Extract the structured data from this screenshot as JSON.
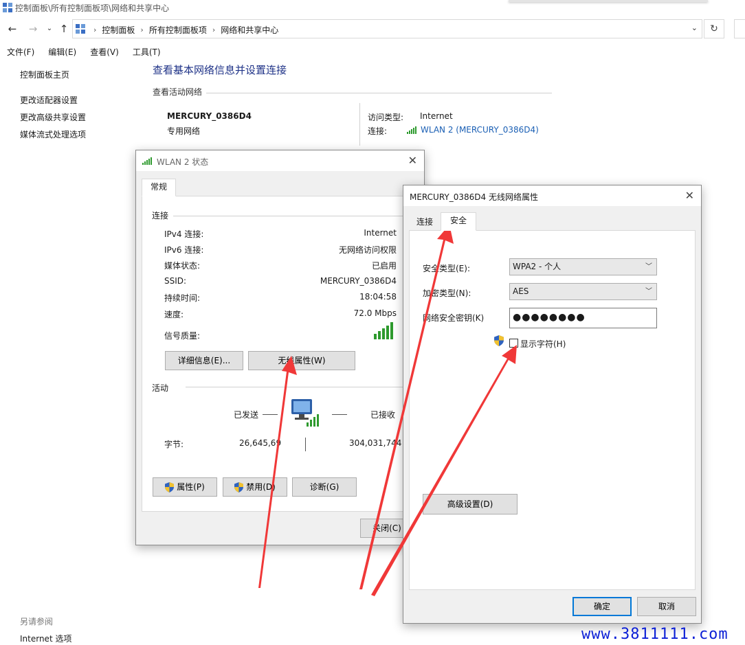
{
  "window": {
    "title": "控制面板\\所有控制面板项\\网络和共享中心"
  },
  "address": {
    "crumbs": [
      "控制面板",
      "所有控制面板项",
      "网络和共享中心"
    ]
  },
  "menu": [
    "文件(F)",
    "编辑(E)",
    "查看(V)",
    "工具(T)"
  ],
  "left_pane": {
    "home": "控制面板主页",
    "links": [
      "更改适配器设置",
      "更改高级共享设置",
      "媒体流式处理选项"
    ],
    "see_also": "另请参阅",
    "internet_options": "Internet 选项"
  },
  "main": {
    "title": "查看基本网络信息并设置连接",
    "active_networks": "查看活动网络",
    "network_name": "MERCURY_0386D4",
    "network_type": "专用网络",
    "access_type_label": "访问类型:",
    "access_type_value": "Internet",
    "connections_label": "连接:",
    "connection_link": "WLAN 2 (MERCURY_0386D4)"
  },
  "wlan_status": {
    "title": "WLAN 2 状态",
    "tab": "常规",
    "connection_group": "连接",
    "rows": [
      {
        "label": "IPv4 连接:",
        "value": "Internet"
      },
      {
        "label": "IPv6 连接:",
        "value": "无网络访问权限"
      },
      {
        "label": "媒体状态:",
        "value": "已启用"
      },
      {
        "label": "SSID:",
        "value": "MERCURY_0386D4"
      },
      {
        "label": "持续时间:",
        "value": "18:04:58"
      },
      {
        "label": "速度:",
        "value": "72.0 Mbps"
      }
    ],
    "signal_label": "信号质量:",
    "details_button": "详细信息(E)...",
    "wireless_props_button": "无线属性(W)",
    "activity_group": "活动",
    "sent_label": "已发送",
    "received_label": "已接收",
    "bytes_label": "字节:",
    "bytes_sent": "26,645,69",
    "bytes_received": "304,031,744",
    "properties_button": "属性(P)",
    "disable_button": "禁用(D)",
    "diagnose_button": "诊断(G)",
    "close_button": "关闭(C)"
  },
  "wireless_props": {
    "title": "MERCURY_0386D4 无线网络属性",
    "tabs": [
      "连接",
      "安全"
    ],
    "security_type_label": "安全类型(E):",
    "security_type_value": "WPA2 - 个人",
    "encryption_type_label": "加密类型(N):",
    "encryption_type_value": "AES",
    "key_label": "网络安全密钥(K)",
    "key_value": "●●●●●●●●",
    "show_chars_label": "显示字符(H)",
    "advanced_button": "高级设置(D)",
    "ok_button": "确定",
    "cancel_button": "取消"
  },
  "watermark": "www.3811111.com",
  "colors": {
    "title_blue": "#1e3287",
    "link_blue": "#1a5fb4",
    "signal_green": "#2e9a2e",
    "arrow_red": "#f03838",
    "watermark_blue": "#0b1fd6"
  }
}
